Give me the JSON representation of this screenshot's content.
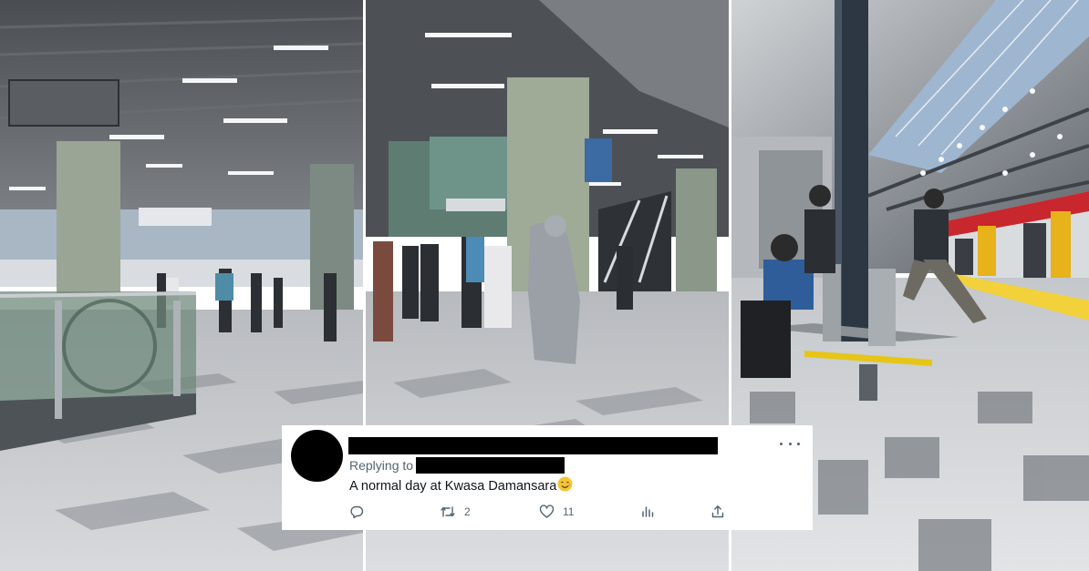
{
  "tweet": {
    "replying_label": "Replying to",
    "text": "A normal day at Kwasa Damansara",
    "emoji_icon": "smiling-face-with-tear-emoji",
    "actions": {
      "reply": {
        "icon": "reply-icon",
        "count": ""
      },
      "retweet": {
        "icon": "retweet-icon",
        "count": "2"
      },
      "like": {
        "icon": "heart-icon",
        "count": "11"
      },
      "views": {
        "icon": "views-chart-icon",
        "count": ""
      },
      "share": {
        "icon": "share-icon",
        "count": ""
      }
    },
    "more_icon": "more-dots-icon"
  },
  "colors": {
    "text_primary": "#0f1419",
    "text_secondary": "#536471",
    "redaction": "#000000",
    "train_red": "#c8282d",
    "train_yellow": "#e8b21a",
    "platform_yellow": "#f2d13a"
  }
}
